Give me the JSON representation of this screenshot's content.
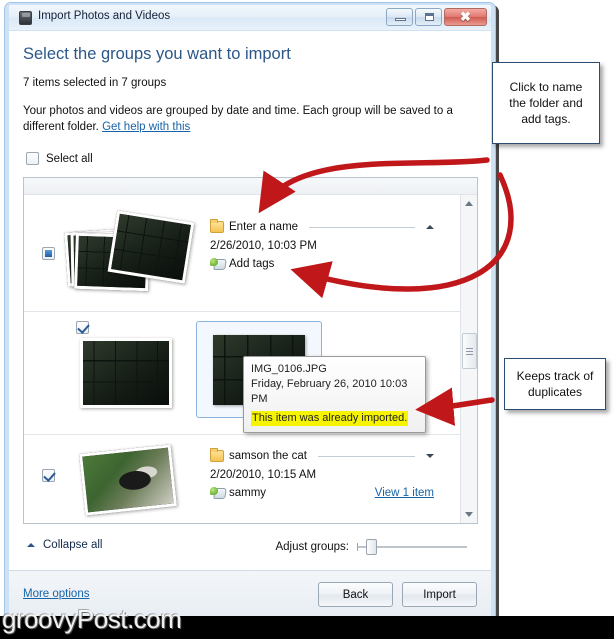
{
  "window": {
    "title": "Import Photos and Videos",
    "icon": "camera-icon",
    "minimize_label": "Minimize",
    "maximize_label": "Maximize",
    "close_label": "✖"
  },
  "page": {
    "title": "Select the groups you want to import",
    "subtitle": "7 items selected in 7 groups",
    "description": "Your photos and videos are grouped by date and time. Each group will be saved to a different folder. ",
    "help_link": "Get help with this",
    "select_all_label": "Select all"
  },
  "groups": [
    {
      "name": "Enter a name",
      "datetime": "2/26/2010, 10:03 PM",
      "tags": "Add tags",
      "checkbox_state": "partial",
      "expander": "up"
    },
    {
      "name": "",
      "datetime": "",
      "tags": "",
      "checkbox_state": "checked",
      "expander": ""
    },
    {
      "name": "samson the cat",
      "datetime": "2/20/2010, 10:15 AM",
      "tags": "sammy",
      "view_link": "View 1 item",
      "checkbox_state": "checked",
      "expander": "down"
    }
  ],
  "tooltip": {
    "filename": "IMG_0106.JPG",
    "date": "Friday, February 26, 2010 10:03 PM",
    "warning": "This item was already imported."
  },
  "bottom": {
    "collapse_all": "Collapse all",
    "adjust_groups": "Adjust groups:",
    "slider_value": 8
  },
  "footer": {
    "more_options": "More options",
    "back_label": "Back",
    "import_label": "Import"
  },
  "callouts": [
    {
      "text": "Click to name the folder and add tags."
    },
    {
      "text": "Keeps track of duplicates"
    }
  ],
  "watermark": "groovyPost.com",
  "colors": {
    "accent": "#2b5788",
    "link": "#1763a8",
    "arrow": "#c0171b",
    "highlight": "#f6f400",
    "frame": "#cfe2f4"
  }
}
